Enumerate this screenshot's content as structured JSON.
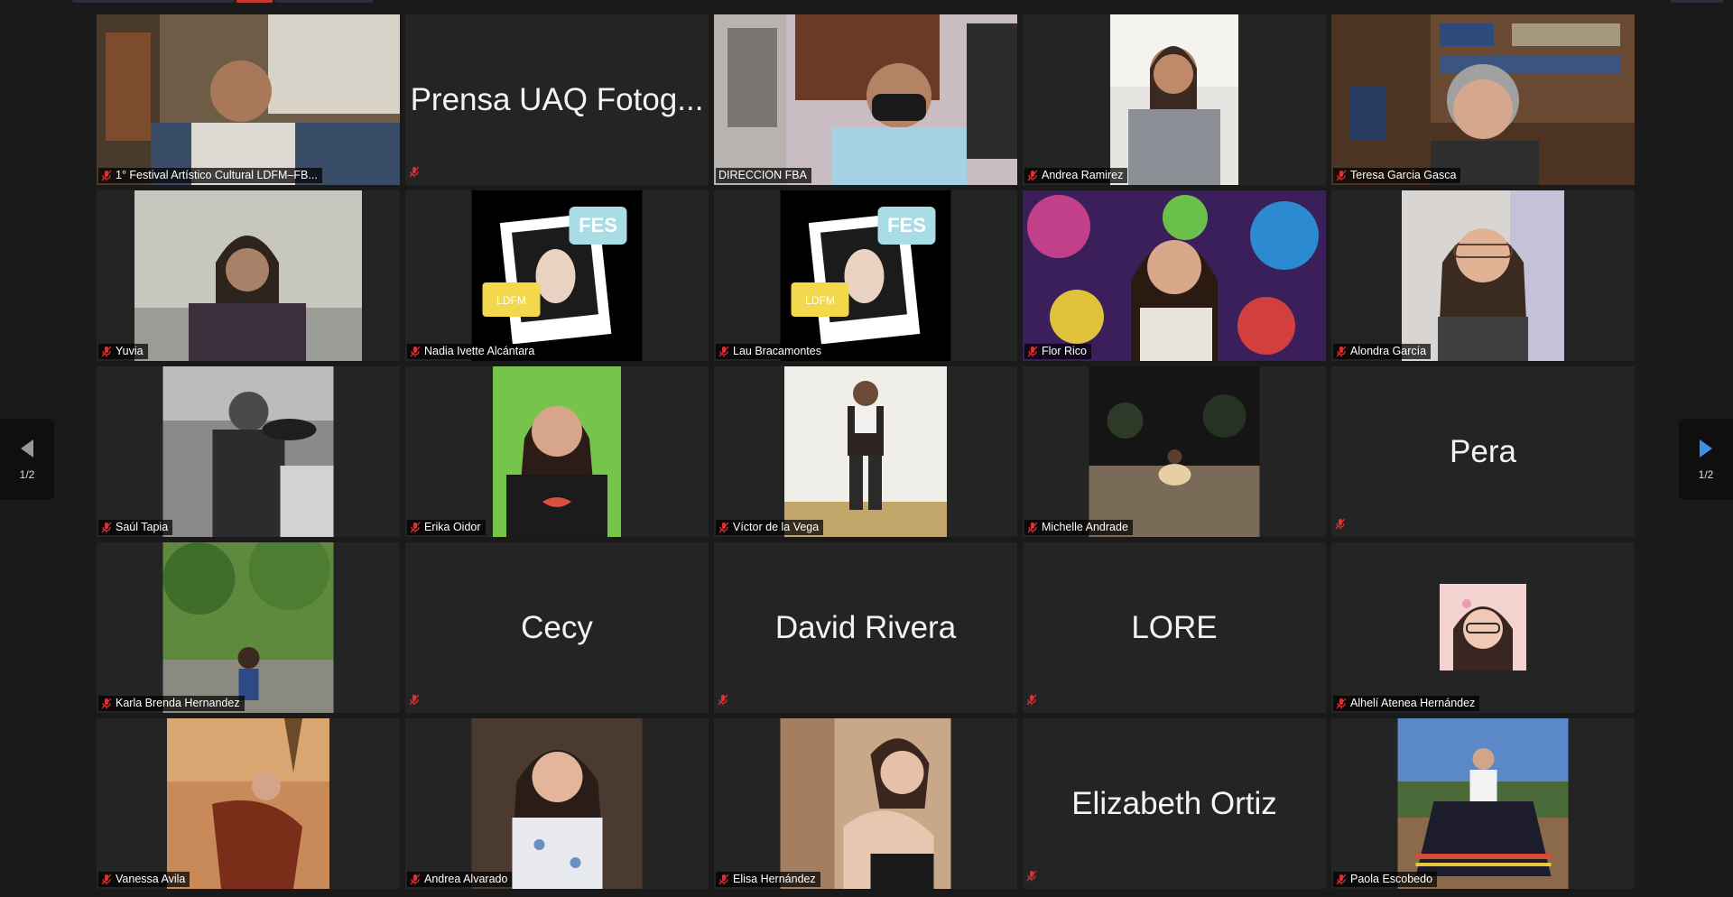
{
  "colors": {
    "background": "#1a1a1a",
    "tile": "#242424",
    "active_border": "#e6da6e",
    "mic_muted": "#e02f2f",
    "nav_arrow_left": "#9a9a9a",
    "nav_arrow_right": "#3d8fe8"
  },
  "navigation": {
    "prev_page": "1/2",
    "next_page": "1/2"
  },
  "participants": [
    {
      "name": "1° Festival Artístico Cultural LDFM–FB...",
      "video": true,
      "muted": true
    },
    {
      "name": "Prensa UAQ Fotog...",
      "video": false,
      "muted": true
    },
    {
      "name": "DIRECCION FBA",
      "video": true,
      "muted": false,
      "active_speaker": true
    },
    {
      "name": "Andrea Ramirez",
      "video": true,
      "muted": true
    },
    {
      "name": "Teresa Garcia Gasca",
      "video": true,
      "muted": true
    },
    {
      "name": "Yuvia",
      "video": true,
      "muted": true
    },
    {
      "name": "Nadia Ivette Alcántara",
      "video": true,
      "muted": true,
      "overlay_text": [
        "FES",
        "LDFM"
      ]
    },
    {
      "name": "Lau Bracamontes",
      "video": true,
      "muted": true,
      "overlay_text": [
        "FES",
        "LDFM"
      ]
    },
    {
      "name": "Flor Rico",
      "video": true,
      "muted": true
    },
    {
      "name": "Alondra García",
      "video": true,
      "muted": true
    },
    {
      "name": "Saúl Tapia",
      "video": true,
      "muted": true
    },
    {
      "name": "Erika Oidor",
      "video": true,
      "muted": true
    },
    {
      "name": "Víctor de la Vega",
      "video": true,
      "muted": true
    },
    {
      "name": "Michelle Andrade",
      "video": true,
      "muted": true
    },
    {
      "name": "Pera",
      "video": false,
      "muted": true
    },
    {
      "name": "Karla Brenda Hernandez",
      "video": true,
      "muted": true
    },
    {
      "name": "Cecy",
      "video": false,
      "muted": true
    },
    {
      "name": "David Rivera",
      "video": false,
      "muted": true
    },
    {
      "name": "LORE",
      "video": false,
      "muted": true
    },
    {
      "name": "Alhelí Atenea Hernández",
      "video": true,
      "muted": true
    },
    {
      "name": "Vanessa Avila",
      "video": true,
      "muted": true
    },
    {
      "name": "Andrea Alvarado",
      "video": true,
      "muted": true
    },
    {
      "name": "Elisa Hernández",
      "video": true,
      "muted": true
    },
    {
      "name": "Elizabeth Ortiz",
      "video": false,
      "muted": true
    },
    {
      "name": "Paola Escobedo",
      "video": true,
      "muted": true
    }
  ]
}
